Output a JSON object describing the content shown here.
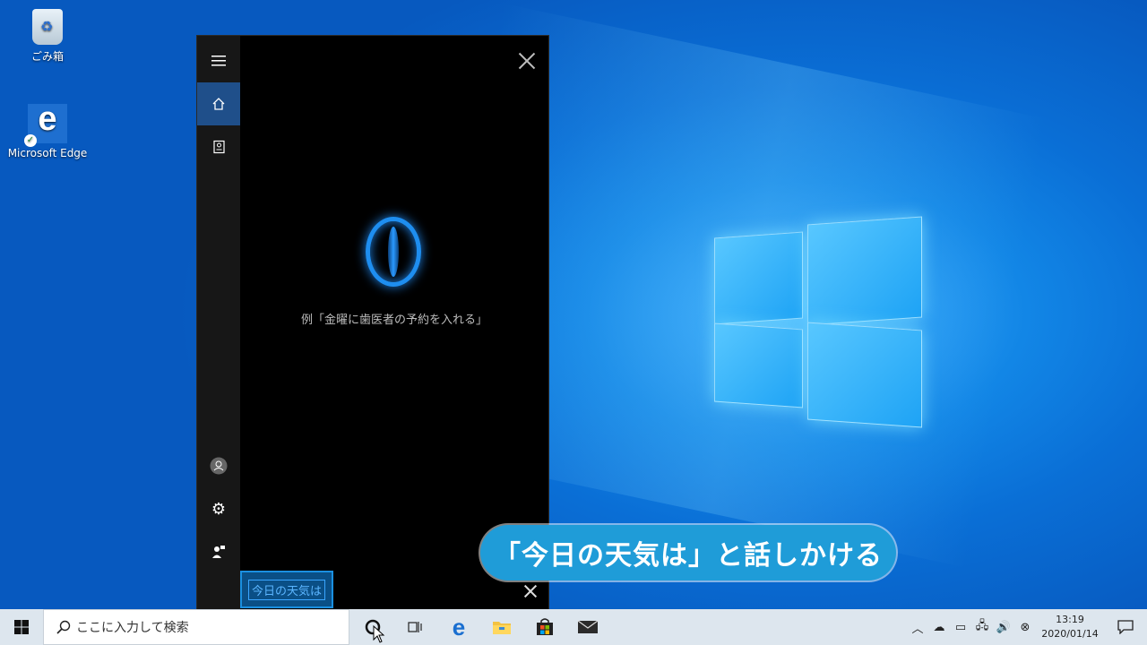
{
  "desktop": {
    "icons": [
      {
        "label": "ごみ箱",
        "icon": "recycle-bin-icon"
      },
      {
        "label": "Microsoft Edge",
        "icon": "edge-icon"
      }
    ]
  },
  "cortana": {
    "hint": "例「金曜に歯医者の予約を入れる」",
    "query": "今日の天気は",
    "rail_icons": [
      "hamburger-menu-icon",
      "home-icon",
      "notebook-icon",
      "account-icon",
      "settings-icon",
      "feedback-icon"
    ]
  },
  "caption": "「今日の天気は」と話しかける",
  "taskbar": {
    "search_placeholder": "ここに入力して検索",
    "clock_time": "13:19",
    "clock_date": "2020/01/14",
    "accent": "#1f9cd8"
  }
}
